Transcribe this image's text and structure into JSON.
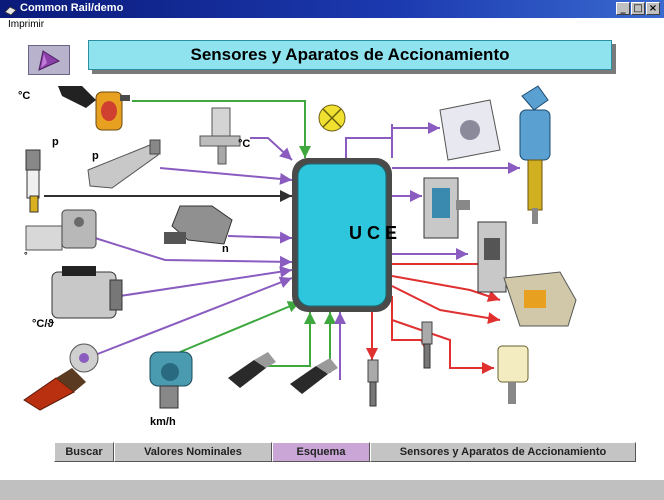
{
  "window": {
    "title": "Common Rail/demo",
    "minimize": "_",
    "maximize": "□",
    "close": "×"
  },
  "menu": {
    "item": "Imprimir"
  },
  "header": {
    "title": "Sensores y Aparatos de Accionamiento"
  },
  "diagram": {
    "ecu_label": "U C E",
    "labels": {
      "temp1": "°C",
      "p1": "p",
      "p2": "p",
      "temp2": "°C",
      "degree": "°",
      "n": "n",
      "temp_theta": "°C/ϑ",
      "kmh": "km/h"
    }
  },
  "buttons": {
    "buscar": "Buscar",
    "valores": "Valores Nominales",
    "esquema": "Esquema",
    "sensores": "Sensores y Aparatos de Accionamiento"
  },
  "colors": {
    "ecu_fill": "#2ec6dc",
    "header_fill": "#8fe3ef",
    "active_button": "#c9a6d6",
    "line_green": "#3ea83e",
    "line_purple": "#8a5cc0",
    "line_red": "#e03030",
    "line_dark": "#303030"
  }
}
